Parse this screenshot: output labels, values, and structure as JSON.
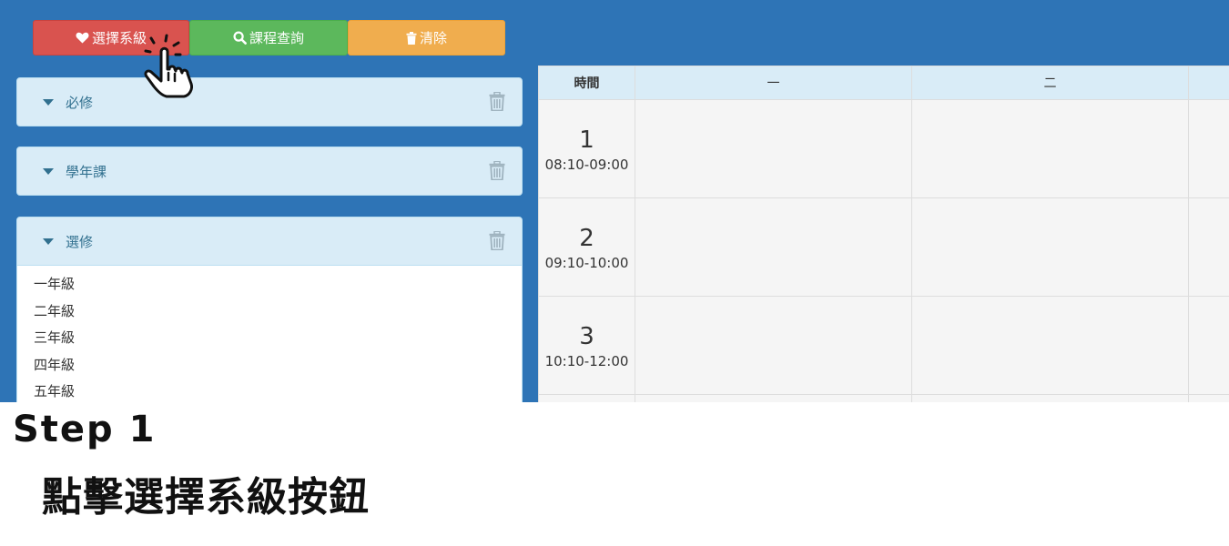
{
  "toolbar": {
    "select_label": "選擇系級",
    "query_label": "課程查詢",
    "clear_label": "清除"
  },
  "panels": [
    {
      "title": "必修"
    },
    {
      "title": "學年課"
    },
    {
      "title": "選修",
      "items": [
        "一年級",
        "二年級",
        "三年級",
        "四年級",
        "五年級"
      ]
    }
  ],
  "timetable": {
    "headers": [
      "時間",
      "一",
      "二"
    ],
    "periods": [
      {
        "number": "1",
        "time": "08:10-09:00"
      },
      {
        "number": "2",
        "time": "09:10-10:00"
      },
      {
        "number": "3",
        "time": "10:10-12:00"
      }
    ]
  },
  "caption": {
    "step": "Step 1",
    "instruction": "點擊選擇系級按鈕"
  },
  "colors": {
    "background": "#2e74b6",
    "select_button": "#d9534f",
    "query_button": "#5cb85c",
    "clear_button": "#f0ad4e",
    "panel": "#d9ecf7"
  },
  "icons": {
    "select_button": "heart-icon",
    "query_button": "search-icon",
    "clear_button": "trash-icon",
    "panel_toggle": "caret-down-icon",
    "panel_delete": "trash-icon",
    "cursor": "hand-pointer-icon"
  }
}
